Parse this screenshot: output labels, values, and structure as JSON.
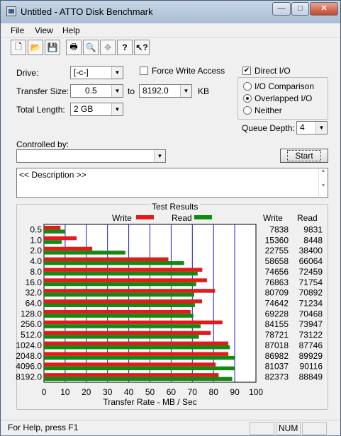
{
  "window": {
    "title": "Untitled - ATTO Disk Benchmark"
  },
  "menu": [
    "File",
    "View",
    "Help"
  ],
  "toolbar": [
    "new-icon",
    "open-icon",
    "save-icon",
    "print-icon",
    "print-preview-icon",
    "move-icon",
    "help-icon",
    "context-help-icon"
  ],
  "settings": {
    "drive_label": "Drive:",
    "drive_value": "[-c-]",
    "force_write_label": "Force Write Access",
    "transfer_size_label": "Transfer Size:",
    "transfer_from": "0.5",
    "to_label": "to",
    "transfer_to": "8192.0",
    "kb_label": "KB",
    "total_length_label": "Total Length:",
    "total_length_value": "2 GB",
    "direct_io_label": "Direct I/O",
    "io_comparison_label": "I/O Comparison",
    "overlapped_io_label": "Overlapped I/O",
    "neither_label": "Neither",
    "queue_depth_label": "Queue Depth:",
    "queue_depth_value": "4",
    "controlled_by_label": "Controlled by:",
    "controlled_by_value": "",
    "start_label": "Start",
    "description": "<< Description >>"
  },
  "results": {
    "group_title": "Test Results",
    "write_col": "Write",
    "read_col": "Read"
  },
  "chart_data": {
    "type": "bar",
    "orientation": "horizontal",
    "categories": [
      "0.5",
      "1.0",
      "2.0",
      "4.0",
      "8.0",
      "16.0",
      "32.0",
      "64.0",
      "128.0",
      "256.0",
      "512.0",
      "1024.0",
      "2048.0",
      "4096.0",
      "8192.0"
    ],
    "series": [
      {
        "name": "Write",
        "color": "#e21a1a",
        "values": [
          7838,
          15360,
          22755,
          58658,
          74656,
          76863,
          80709,
          74642,
          69228,
          84155,
          78721,
          87018,
          86982,
          81037,
          82373
        ]
      },
      {
        "name": "Read",
        "color": "#118a11",
        "values": [
          9831,
          8448,
          38400,
          66064,
          72459,
          71754,
          70892,
          71234,
          70468,
          73947,
          73122,
          87746,
          89929,
          90116,
          88849
        ]
      }
    ],
    "plotted_write": [
      7.8,
      15.4,
      22.8,
      58.7,
      74.7,
      76.9,
      80.7,
      74.6,
      69.2,
      84.2,
      78.7,
      87.0,
      87.0,
      81.0,
      82.4
    ],
    "plotted_read": [
      9.8,
      8.4,
      38.4,
      66.1,
      72.5,
      71.8,
      70.9,
      71.2,
      70.5,
      73.9,
      73.1,
      87.7,
      89.9,
      90.1,
      88.8
    ],
    "xlabel": "Transfer Rate - MB / Sec",
    "xlim": [
      0,
      100
    ],
    "xticks": [
      "0",
      "10",
      "20",
      "30",
      "40",
      "50",
      "60",
      "70",
      "80",
      "90",
      "100"
    ],
    "grid": true,
    "legend_position": "top"
  },
  "status": {
    "left": "For Help, press F1",
    "num": "NUM"
  }
}
